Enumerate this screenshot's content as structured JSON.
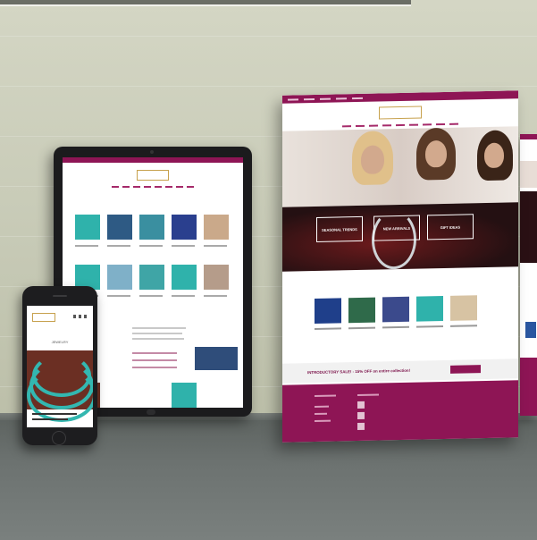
{
  "scene": {
    "description_colors": {
      "wall": "#c9cbb8",
      "desk": "#6c7270",
      "brand": "#8e1555"
    }
  },
  "desktop_page": {
    "band_boxes": [
      "SEASONAL TRENDS",
      "NEW ARRIVALS",
      "GIFT IDEAS"
    ],
    "promo_text": "INTRODUCTORY SALE! - 15% OFF on entire collection!"
  },
  "tablet_page": {},
  "phone_page": {
    "section_title": "JEWELRY"
  }
}
